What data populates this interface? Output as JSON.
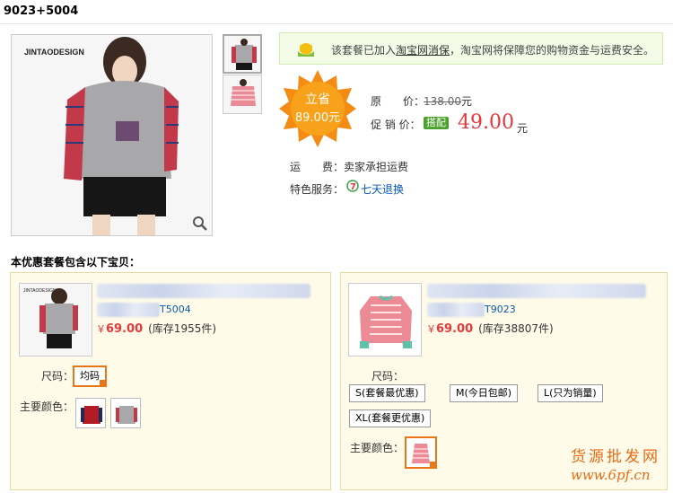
{
  "page": {
    "title": "9023+5004"
  },
  "notice": {
    "before": "该套餐已加入",
    "link": "淘宝网消保",
    "after": "，淘宝网将保障您的购物资金与运费安全。"
  },
  "badge": {
    "line1": "立省",
    "line2": "89.00元"
  },
  "price": {
    "original_label": "原　　价：",
    "original_value": "138.00",
    "original_unit": "元",
    "promo_label": "促 销 价：",
    "promo_tag": "搭配",
    "promo_value": "49.00",
    "promo_unit": "元"
  },
  "shipping": {
    "label": "运　　费：",
    "value": "卖家承担运费"
  },
  "service": {
    "label": "特色服务：",
    "value": "七天退换"
  },
  "section_title": "本优惠套餐包含以下宝贝：",
  "product1": {
    "code": "T5004",
    "currency": "￥",
    "price": "69.00",
    "stock": "(库存1955件)",
    "size_label": "尺码：",
    "sizes": [
      "均码"
    ],
    "color_label": "主要颜色："
  },
  "product2": {
    "code": "T9023",
    "currency": "￥",
    "price": "69.00",
    "stock": "(库存38807件)",
    "size_label": "尺码：",
    "sizes": [
      "S(套餐最优惠)",
      "M(今日包邮)",
      "L(只为销量)",
      "XL(套餐更优惠)"
    ],
    "color_label": "主要颜色："
  },
  "watermark": {
    "line1": "货源批发网",
    "line2": "www.6pf.cn"
  },
  "image_text": {
    "brand": "JINTAODESIGN"
  },
  "colors": {
    "accent_red": "#e4393c",
    "select_orange": "#e8771a",
    "link_blue": "#0a59b5",
    "tag_green": "#4aa12c"
  }
}
